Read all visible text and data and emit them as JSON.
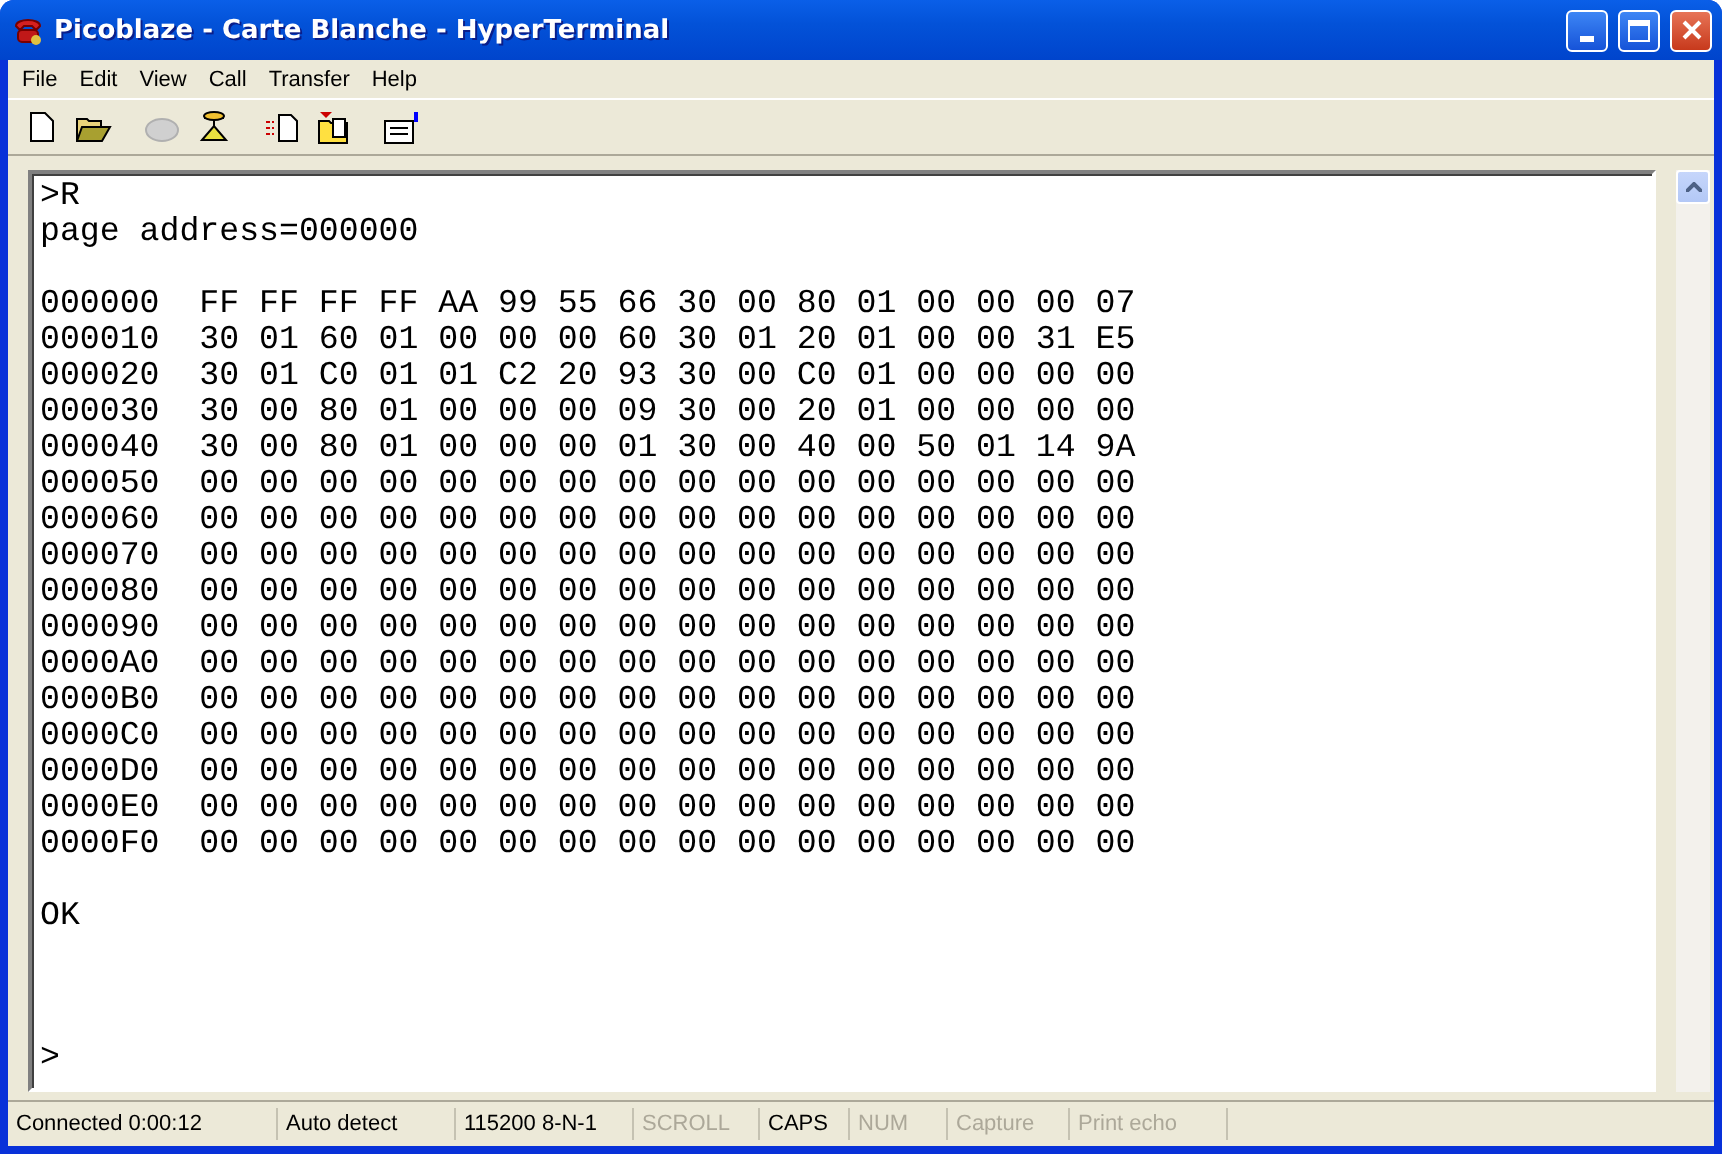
{
  "window": {
    "title": "Picoblaze - Carte Blanche - HyperTerminal"
  },
  "menu": [
    "File",
    "Edit",
    "View",
    "Call",
    "Transfer",
    "Help"
  ],
  "toolbar": [
    {
      "kind": "new",
      "disabled": false
    },
    {
      "kind": "open",
      "disabled": false
    },
    {
      "kind": "call",
      "disabled": true
    },
    {
      "kind": "hangup",
      "disabled": false
    },
    {
      "kind": "send",
      "disabled": false
    },
    {
      "kind": "receive",
      "disabled": false
    },
    {
      "kind": "properties",
      "disabled": false
    }
  ],
  "terminal": {
    "blocks": [
      [
        ">R",
        "page address=000000"
      ],
      [
        "000000  FF FF FF FF AA 99 55 66 30 00 80 01 00 00 00 07",
        "000010  30 01 60 01 00 00 00 60 30 01 20 01 00 00 31 E5",
        "000020  30 01 C0 01 01 C2 20 93 30 00 C0 01 00 00 00 00",
        "000030  30 00 80 01 00 00 00 09 30 00 20 01 00 00 00 00",
        "000040  30 00 80 01 00 00 00 01 30 00 40 00 50 01 14 9A",
        "000050  00 00 00 00 00 00 00 00 00 00 00 00 00 00 00 00",
        "000060  00 00 00 00 00 00 00 00 00 00 00 00 00 00 00 00",
        "000070  00 00 00 00 00 00 00 00 00 00 00 00 00 00 00 00",
        "000080  00 00 00 00 00 00 00 00 00 00 00 00 00 00 00 00",
        "000090  00 00 00 00 00 00 00 00 00 00 00 00 00 00 00 00",
        "0000A0  00 00 00 00 00 00 00 00 00 00 00 00 00 00 00 00",
        "0000B0  00 00 00 00 00 00 00 00 00 00 00 00 00 00 00 00",
        "0000C0  00 00 00 00 00 00 00 00 00 00 00 00 00 00 00 00",
        "0000D0  00 00 00 00 00 00 00 00 00 00 00 00 00 00 00 00",
        "0000E0  00 00 00 00 00 00 00 00 00 00 00 00 00 00 00 00",
        "0000F0  00 00 00 00 00 00 00 00 00 00 00 00 00 00 00 00"
      ],
      [
        "OK"
      ]
    ],
    "prompt": ">"
  },
  "status_bar": [
    {
      "text": "Connected 0:00:12",
      "disabled": false
    },
    {
      "text": "Auto detect",
      "disabled": false
    },
    {
      "text": "115200 8-N-1",
      "disabled": false
    },
    {
      "text": "SCROLL",
      "disabled": true
    },
    {
      "text": "CAPS",
      "disabled": false
    },
    {
      "text": "NUM",
      "disabled": true
    },
    {
      "text": "Capture",
      "disabled": true
    },
    {
      "text": "Print echo",
      "disabled": true
    }
  ]
}
